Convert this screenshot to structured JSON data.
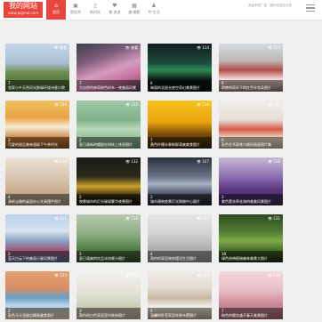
{
  "header": {
    "logo_title": "我的网站",
    "logo_subtitle": "www.pigmal.com",
    "slogan": "欢迎来到广告 · 图片欣赏站为您",
    "nav": [
      {
        "label": "首页",
        "icon": "⌂"
      },
      {
        "label": "壁纸秀",
        "icon": "▣"
      },
      {
        "label": "新科技",
        "icon": "▯"
      },
      {
        "label": "美·旅游",
        "icon": "♥"
      },
      {
        "label": "趣·摄影",
        "icon": "▦"
      },
      {
        "label": "夸·生活",
        "icon": "♟"
      }
    ]
  },
  "cards": [
    {
      "badge": "👁 查看",
      "count": "7",
      "caption": "农家小乡天然风光鲜绿环绕诗意小院",
      "bg": "linear-gradient(180deg,#c5d6e6 0%,#a9c0d3 40%,#6f8f4f 60%,#3f5f2b 100%)"
    },
    {
      "badge": "👁 查看",
      "count": "7",
      "caption": "大自然的神奇粉色树木一夜美丽风景",
      "bg": "linear-gradient(160deg,#3a3f4b 0%,#7d5c79 30%,#d89bbf 55%,#c46f9b 75%,#4d3a44 100%)"
    },
    {
      "badge": "👁 114",
      "count": "6",
      "caption": "绚丽的北极光夜空奇幻美景图片",
      "bg": "linear-gradient(180deg,#0f1b1e 0%,#1e4a3a 40%,#2f8a5a 55%,#0e1b16 75%,#0a0f10 100%)"
    },
    {
      "badge": "👁 124",
      "count": "9",
      "caption": "明艳的雨伞下的红色伞花朵图片",
      "bg": "linear-gradient(180deg,#d4dae0 0%,#c0b9b6 35%,#b24c4c 55%,#f4e1dc 75%,#8c6e6b 100%)"
    },
    {
      "badge": "👁 150",
      "count": "3",
      "caption": "可爱的甜品美味蛋糕下午茶时光",
      "bg": "linear-gradient(180deg,#efc25f 0%,#e9a244 35%,#f7ecd2 55%,#c97f3b 80%,#7c4a22 100%)"
    },
    {
      "badge": "👁 125",
      "count": "2",
      "caption": "夏日清新的蜻蜓在树枝上休息图片",
      "bg": "linear-gradient(180deg,#a0c8a7 0%,#7fb28c 40%,#b9d9b9 60%,#6c9b76 100%)"
    },
    {
      "badge": "👁 116",
      "count": "7",
      "caption": "黄色柠檬水果新鲜清爽美食图片",
      "bg": "linear-gradient(180deg,#f6c51d 0%,#e8a30c 45%,#7a4c0a 70%,#2e1f09 100%)"
    },
    {
      "badge": "👁 124",
      "count": "6",
      "caption": "彩色艺术画笔与颜料画画图片集",
      "bg": "linear-gradient(180deg,#f0ede9 0%,#e6dfd7 40%,#d65b4b 60%,#f3e6d0 80%,#b4a89a 100%)"
    },
    {
      "badge": "👁 118",
      "count": "4",
      "caption": "清新淡雅的桌面办公文具摆件照片",
      "bg": "linear-gradient(180deg,#ede3d6 0%,#d9c6b0 40%,#c9b092 70%,#a08b74 100%)"
    },
    {
      "badge": "👁 132",
      "count": "2",
      "caption": "夜晚城市的灯光璀璨繁华夜景图片",
      "bg": "linear-gradient(180deg,#1b1a14 0%,#2a2a1a 40%,#c9a02a 60%,#3a2f10 80%,#0f0d08 100%)"
    },
    {
      "badge": "👁 107",
      "count": "2",
      "caption": "城市建筑夜景灯光购物中心图片",
      "bg": "linear-gradient(180deg,#2a3140 0%,#6a7486 40%,#a7b2c4 55%,#3b4252 80%,#1c2029 100%)"
    },
    {
      "badge": "👁 118",
      "count": "3",
      "caption": "紫色薰衣草花海的唯美风景图片",
      "bg": "linear-gradient(180deg,#c7b9d6 0%,#8d6fb1 40%,#5d3b82 65%,#3a2550 100%)"
    },
    {
      "badge": "👁 121",
      "count": "2",
      "caption": "蓝天白云下的美丽小屋风景图片",
      "bg": "linear-gradient(180deg,#b9d1e8 0%,#d6e3ef 35%,#8aa2c1 55%,#a0577a 75%,#4e6a8d 100%)"
    },
    {
      "badge": "👁 118",
      "count": "3",
      "caption": "夏日清爽的饮品冰块果汁图片",
      "bg": "linear-gradient(180deg,#b8c9b0 0%,#8fae86 40%,#5e8a52 65%,#2f4a28 100%)"
    },
    {
      "badge": "👁 127",
      "count": "4",
      "caption": "简约的家居装饰摆设生活图片",
      "bg": "linear-gradient(180deg,#e6e6e6 0%,#d2d2d2 40%,#bdbdbd 60%,#8e8e8e 100%)"
    },
    {
      "badge": "👁 131",
      "count": "18",
      "caption": "绿色热带植物森林美景大图片",
      "bg": "linear-gradient(180deg,#2f4a22 0%,#4f7a32 35%,#7eaa49 55%,#3b5d24 80%,#1b2a12 100%)"
    },
    {
      "badge": "👁 124",
      "count": "2",
      "caption": "彩色马卡龙甜点精致美食照片",
      "bg": "linear-gradient(180deg,#e2a072 0%,#d98f63 35%,#6a9ec8 55%,#b5d3e9 70%,#e2c7a3 100%)"
    },
    {
      "badge": "👁 118",
      "count": "3",
      "caption": "简约的白色家居室内装饰图片",
      "bg": "linear-gradient(180deg,#f2f2ef 0%,#e7e3da 40%,#d3d8c3 60%,#b7ad99 100%)"
    },
    {
      "badge": "👁 120",
      "count": "4",
      "caption": "温馨的卧室家居软装布置图片",
      "bg": "linear-gradient(180deg,#efebe5 0%,#e3dcd1 35%,#c7b8a4 55%,#f4efe8 75%,#b39d83 100%)"
    },
    {
      "badge": "👁 119",
      "count": "7",
      "caption": "粉色的樱花盛开春天美景图片",
      "bg": "linear-gradient(180deg,#f4d9dc 0%,#e8bcc4 40%,#cf8e9b 65%,#9f6470 100%)"
    }
  ]
}
